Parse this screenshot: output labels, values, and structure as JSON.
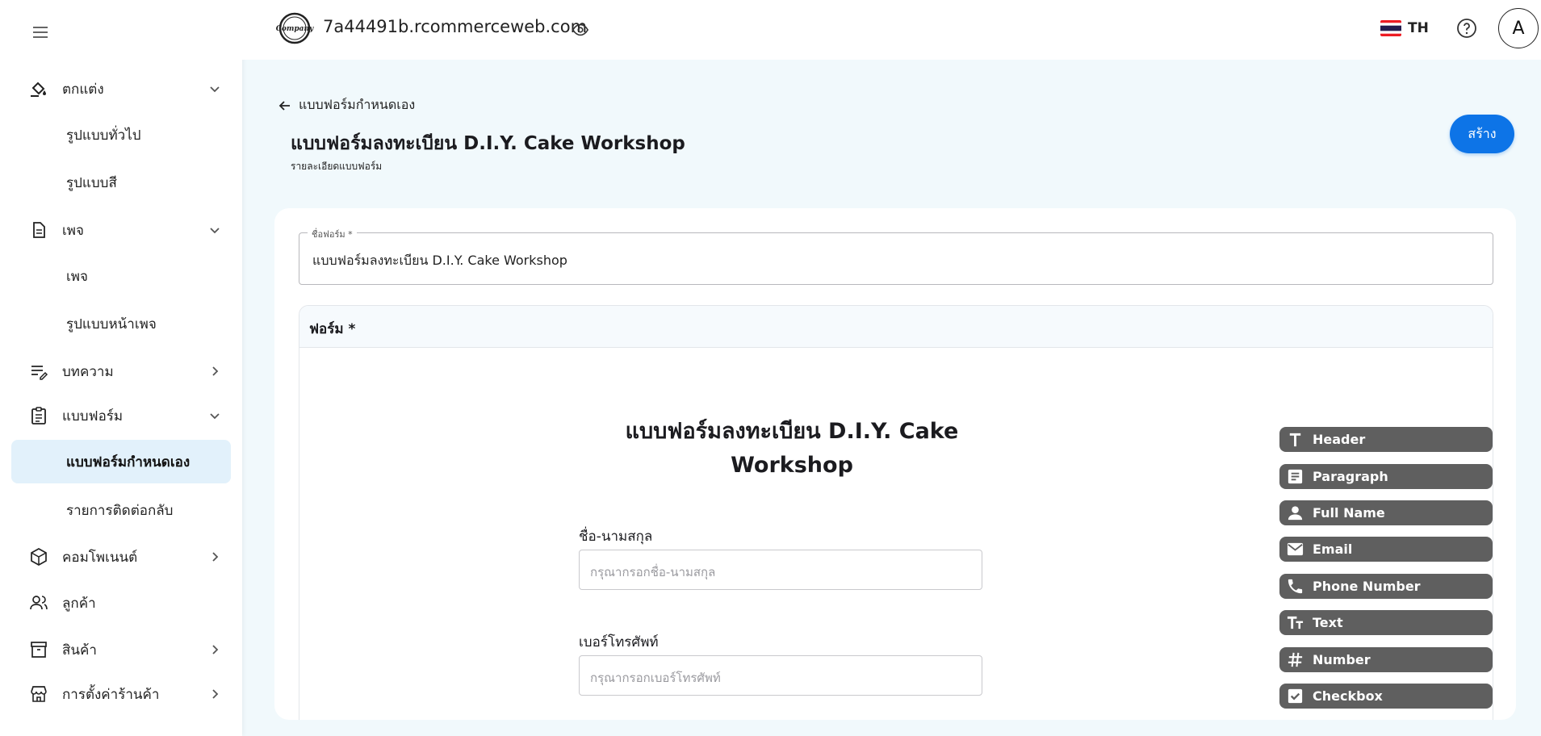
{
  "header": {
    "domain": "7a44491b.rcommerceweb.com",
    "language": "TH",
    "avatar_initial": "A",
    "logo_text": "Company"
  },
  "sidebar": {
    "items": [
      {
        "label": "ตกแต่ง",
        "icon": "paint-bucket-icon",
        "expanded": true
      },
      {
        "label": "รูปแบบทั่วไป",
        "sub": true
      },
      {
        "label": "รูปแบบสี",
        "sub": true
      },
      {
        "label": "เพจ",
        "icon": "page-icon",
        "expanded": true
      },
      {
        "label": "เพจ",
        "sub": true
      },
      {
        "label": "รูปแบบหน้าเพจ",
        "sub": true
      },
      {
        "label": "บทความ",
        "icon": "article-edit-icon",
        "expanded": false
      },
      {
        "label": "แบบฟอร์ม",
        "icon": "clipboard-icon",
        "expanded": true
      },
      {
        "label": "แบบฟอร์มกำหนดเอง",
        "sub": true,
        "active": true
      },
      {
        "label": "รายการติดต่อกลับ",
        "sub": true
      },
      {
        "label": "คอมโพเนนต์",
        "icon": "cube-icon",
        "expanded": false
      },
      {
        "label": "ลูกค้า",
        "icon": "users-icon"
      },
      {
        "label": "สินค้า",
        "icon": "archive-icon",
        "expanded": false
      },
      {
        "label": "การตั้งค่าร้านค้า",
        "icon": "store-icon",
        "expanded": false
      }
    ]
  },
  "page": {
    "back_label": "แบบฟอร์มกำหนดเอง",
    "title": "แบบฟอร์มลงทะเบียน D.I.Y. Cake Workshop",
    "subtitle": "รายละเอียดแบบฟอร์ม",
    "create_label": "สร้าง"
  },
  "form_name": {
    "label": "ชื่อฟอร์ม *",
    "value": "แบบฟอร์มลงทะเบียน D.I.Y. Cake Workshop"
  },
  "form_builder": {
    "section_title": "ฟอร์ม *",
    "preview_title_line1": "แบบฟอร์มลงทะเบียน D.I.Y. Cake",
    "preview_title_line2": "Workshop",
    "fields": [
      {
        "label": "ชื่อ-นามสกุล",
        "placeholder": "กรุณากรอกชื่อ-นามสกุล"
      },
      {
        "label": "เบอร์โทรศัพท์",
        "placeholder": "กรุณากรอกเบอร์โทรศัพท์"
      }
    ],
    "palette": [
      {
        "label": "Header",
        "icon": "header-t-icon"
      },
      {
        "label": "Paragraph",
        "icon": "paragraph-icon"
      },
      {
        "label": "Full Name",
        "icon": "person-icon"
      },
      {
        "label": "Email",
        "icon": "envelope-icon"
      },
      {
        "label": "Phone Number",
        "icon": "phone-icon"
      },
      {
        "label": "Text",
        "icon": "text-size-icon"
      },
      {
        "label": "Number",
        "icon": "hash-icon"
      },
      {
        "label": "Checkbox",
        "icon": "checkbox-icon"
      }
    ]
  },
  "colors": {
    "accent": "#0d74e7",
    "background": "#f1f9fc",
    "chip": "#5f5f5f",
    "active_nav": "#e2f1fb"
  }
}
